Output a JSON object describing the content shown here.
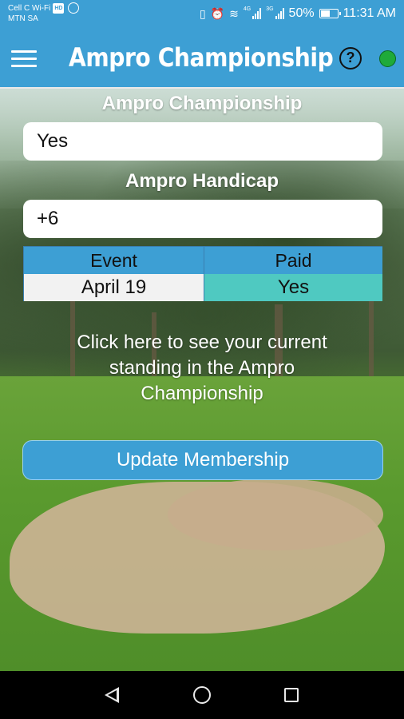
{
  "status_bar": {
    "carrier_line1": "Cell C Wi-Fi",
    "hd_badge": "HD",
    "carrier_line2": "MTN SA",
    "network_1": "4G",
    "network_2": "3G",
    "battery": "50%",
    "time": "11:31 AM"
  },
  "app_bar": {
    "title": "Ampro Championship",
    "help_icon": "?",
    "status_color": "#1faa3a"
  },
  "championship": {
    "label": "Ampro Championship",
    "value": "Yes"
  },
  "handicap": {
    "label": "Ampro Handicap",
    "value": "+6"
  },
  "events_table": {
    "headers": [
      "Event",
      "Paid"
    ],
    "rows": [
      [
        "April 19",
        "Yes"
      ]
    ]
  },
  "standing_link": "Click here to see your current standing in the Ampro Championship",
  "update_button": "Update Membership",
  "colors": {
    "accent": "#3d9fd4",
    "paid_cell": "#4fc9c1"
  }
}
